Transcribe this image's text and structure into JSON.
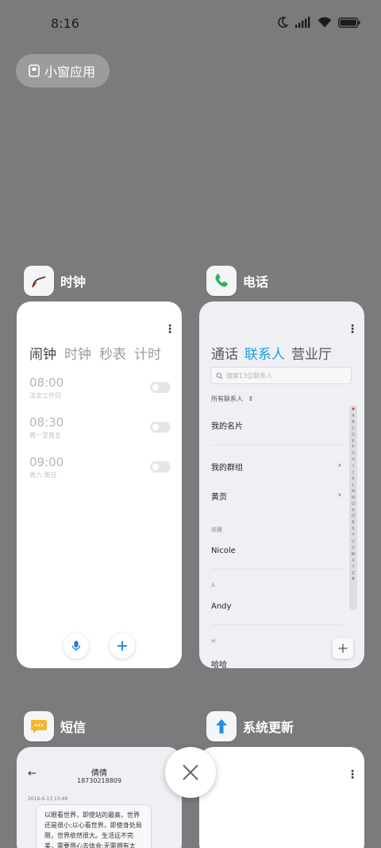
{
  "status_bar": {
    "time": "8:16"
  },
  "small_window": {
    "label": "小窗应用"
  },
  "apps": {
    "clock": {
      "name": "时钟",
      "tabs": [
        "闹钟",
        "时钟",
        "秒表",
        "计时"
      ],
      "alarms": [
        {
          "time": "08:00",
          "repeat": "法定工作日",
          "enabled": false
        },
        {
          "time": "08:30",
          "repeat": "周一至周五",
          "enabled": false
        },
        {
          "time": "09:00",
          "repeat": "周六 周日",
          "enabled": false
        }
      ]
    },
    "phone": {
      "name": "电话",
      "tabs": [
        "通话",
        "联系人",
        "营业厅"
      ],
      "search_placeholder": "搜索13位联系人",
      "filter_label": "所有联系人",
      "items": {
        "my_card": "我的名片",
        "my_groups": "我的群组",
        "yellow_pages": "黄页"
      },
      "sections": [
        {
          "header": "收藏",
          "contact": "Nicole"
        },
        {
          "header": "A",
          "contact": "Andy"
        },
        {
          "header": "H",
          "contact": "哈哈"
        }
      ],
      "alphabet": [
        "♥",
        "A",
        "B",
        "C",
        "D",
        "E",
        "F",
        "G",
        "H",
        "I",
        "J",
        "K",
        "L",
        "M",
        "N",
        "O",
        "P",
        "Q",
        "R",
        "S",
        "T",
        "U",
        "V",
        "W",
        "X",
        "Y",
        "Z",
        "#"
      ]
    },
    "sms": {
      "name": "短信",
      "contact_name": "倩倩",
      "contact_number": "18730218809",
      "date": "2016-6-13 13:49",
      "message": "以眼看世界，即使站的最高，世界还是很小;以心看世界，即使身处局限，世界依然很大。生活远不完美，需要用心去体会;无需拥有太"
    },
    "update": {
      "name": "系统更新"
    }
  },
  "colors": {
    "accent": "#1a9fe0",
    "background": "#7a7b7d"
  }
}
